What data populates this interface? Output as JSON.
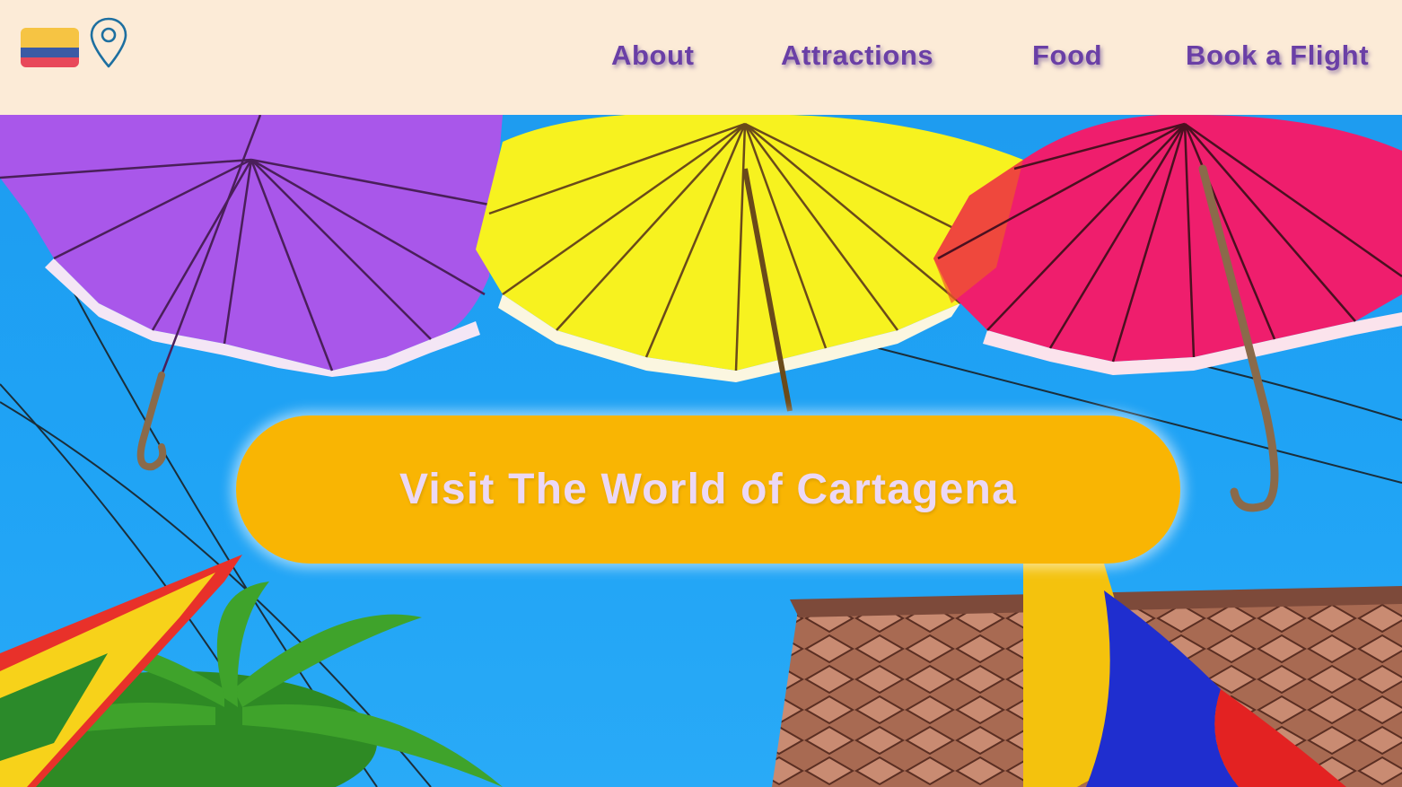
{
  "header": {
    "flag_colors": {
      "yellow": "#f6c443",
      "blue": "#3b5ba5",
      "red": "#e8485a"
    },
    "location_icon": "map-pin-icon",
    "pin_color": "#1d6fa0"
  },
  "nav": {
    "color": "#6a3fa6",
    "items": [
      {
        "label": "About"
      },
      {
        "label": "Attractions"
      },
      {
        "label": "Food"
      },
      {
        "label": "Book a Flight"
      }
    ]
  },
  "hero": {
    "image": "colorful-umbrellas-cartagena",
    "cta_label": "Visit The World of Cartagena",
    "cta_bg": "#f9b503",
    "cta_text_color": "#ecd8f5",
    "umbrella_colors": [
      "#a855e8",
      "#f5f11a",
      "#ef1f6e"
    ]
  }
}
